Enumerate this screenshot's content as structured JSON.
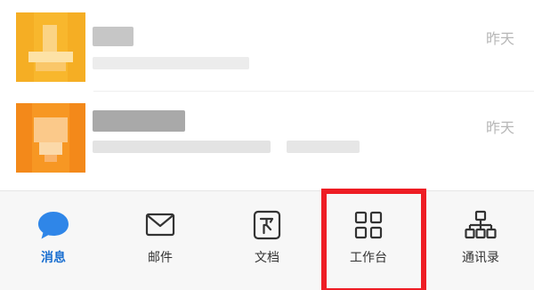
{
  "messages": [
    {
      "time": "昨天",
      "avatar_color": "#f6b128"
    },
    {
      "time": "昨天",
      "avatar_color": "#f6911e"
    }
  ],
  "tabs": [
    {
      "label": "消息",
      "icon": "chat-bubble-icon",
      "active": true
    },
    {
      "label": "邮件",
      "icon": "mail-icon",
      "active": false
    },
    {
      "label": "文档",
      "icon": "document-icon",
      "active": false
    },
    {
      "label": "工作台",
      "icon": "grid-icon",
      "active": false
    },
    {
      "label": "通讯录",
      "icon": "org-chart-icon",
      "active": false
    }
  ],
  "colors": {
    "accent": "#1a6fd0",
    "highlight": "#ee1d24"
  }
}
